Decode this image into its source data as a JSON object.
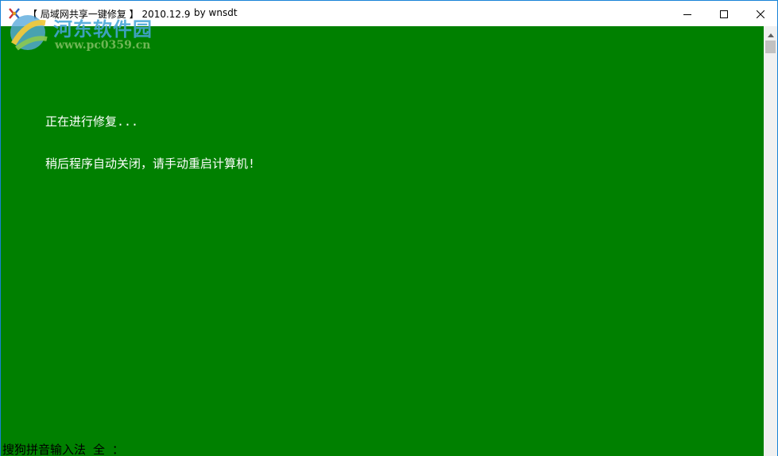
{
  "window": {
    "title": "【 局域网共享一键修复 】 2010.12.9",
    "author": "by wnsdt"
  },
  "watermark": {
    "name": "河东软件园",
    "url": "www.pc0359.cn"
  },
  "console": {
    "lines": [
      "正在进行修复...",
      "稍后程序自动关闭，请手动重启计算机!"
    ],
    "ime_status": "搜狗拼音输入法 全 ："
  },
  "colors": {
    "console_background": "#008000",
    "console_text": "#ffffff",
    "window_border": "#1883d7"
  },
  "icons": {
    "app": "app-icon",
    "minimize": "minimize-icon",
    "maximize": "maximize-icon",
    "close": "close-icon",
    "scroll_up": "scroll-up-arrow-icon"
  }
}
